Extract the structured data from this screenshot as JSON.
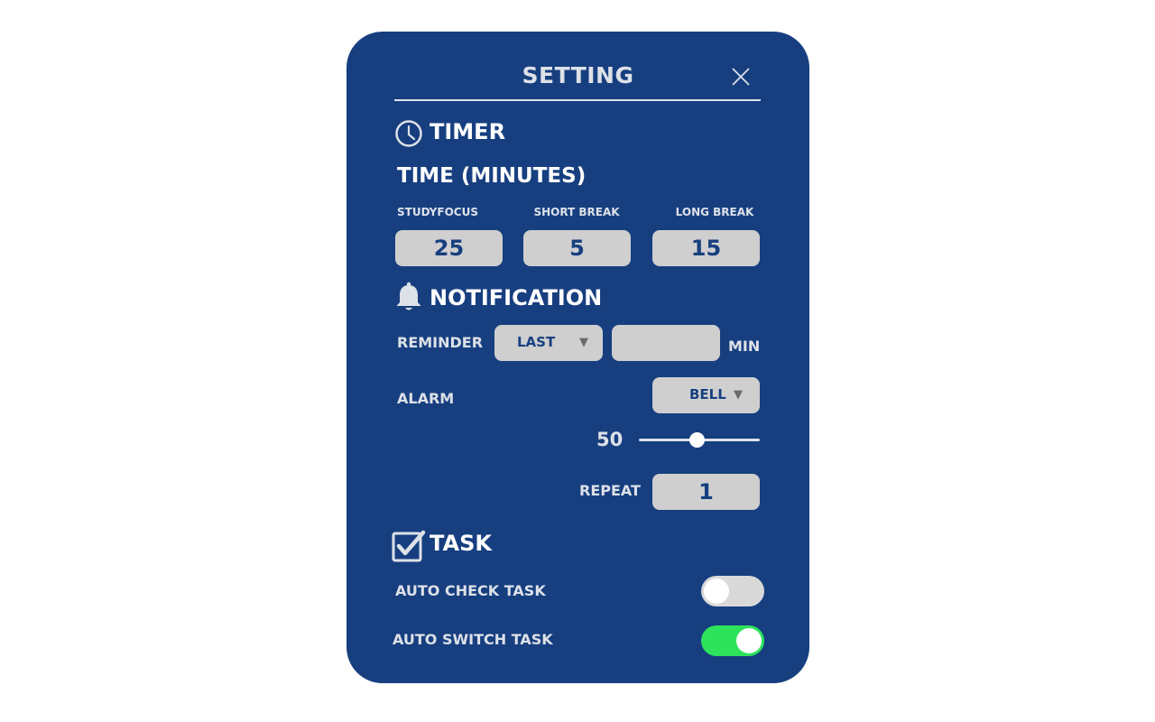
{
  "header": {
    "title": "SETTING"
  },
  "timer": {
    "section_title": "TIMER",
    "subtitle": "TIME (MINUTES)",
    "columns": [
      {
        "label": "STUDYFOCUS",
        "value": "25"
      },
      {
        "label": "SHORT BREAK",
        "value": "5"
      },
      {
        "label": "LONG BREAK",
        "value": "15"
      }
    ]
  },
  "notification": {
    "section_title": "NOTIFICATION",
    "reminder": {
      "label": "REMINDER",
      "selected": "LAST",
      "minutes_value": "",
      "unit": "MIN"
    },
    "alarm": {
      "label": "ALARM",
      "selected": "BELL"
    },
    "volume": {
      "value": "50",
      "fraction": 0.5
    },
    "repeat": {
      "label": "REPEAT",
      "value": "1"
    }
  },
  "task": {
    "section_title": "TASK",
    "auto_check": {
      "label": "AUTO CHECK TASK",
      "on": false
    },
    "auto_switch": {
      "label": "AUTO SWITCH TASK",
      "on": true
    }
  },
  "colors": {
    "panel": "#173f80",
    "input": "#cfcfcf",
    "toggle_on": "#2de35c",
    "toggle_off": "#d9d9d9",
    "text_light": "#dde1e8"
  },
  "icons": {
    "close": "close-icon",
    "timer": "clock-icon",
    "notification": "bell-icon",
    "task": "checkbox-icon",
    "dropdown": "caret-down-icon"
  }
}
